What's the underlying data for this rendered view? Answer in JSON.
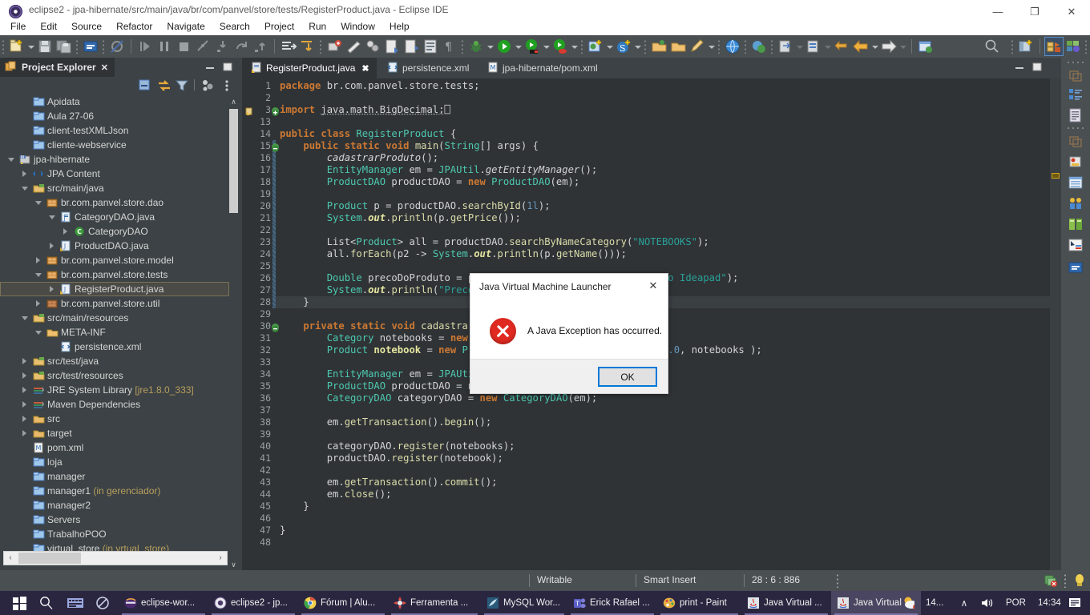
{
  "window": {
    "title": "eclipse2 - jpa-hibernate/src/main/java/br/com/panvel/store/tests/RegisterProduct.java - Eclipse IDE",
    "minimize": "—",
    "maximize": "❐",
    "close": "✕"
  },
  "menubar": [
    {
      "label": "File"
    },
    {
      "label": "Edit"
    },
    {
      "label": "Source"
    },
    {
      "label": "Refactor"
    },
    {
      "label": "Navigate"
    },
    {
      "label": "Search"
    },
    {
      "label": "Project"
    },
    {
      "label": "Run"
    },
    {
      "label": "Window"
    },
    {
      "label": "Help"
    }
  ],
  "project_explorer": {
    "tab_label": "Project Explorer",
    "tab_close": "✕",
    "tree": [
      {
        "label": "Apidata",
        "indent": 1,
        "icon": "project-closed",
        "arrow": "none"
      },
      {
        "label": "Aula 27-06",
        "indent": 1,
        "icon": "project-closed",
        "arrow": "none"
      },
      {
        "label": "client-testXMLJson",
        "indent": 1,
        "icon": "project-closed",
        "arrow": "none"
      },
      {
        "label": "cliente-webservice",
        "indent": 1,
        "icon": "project-closed",
        "arrow": "none"
      },
      {
        "label": "jpa-hibernate",
        "indent": 0,
        "icon": "maven-project",
        "arrow": "open"
      },
      {
        "label": "JPA Content",
        "indent": 1,
        "icon": "jpa-content",
        "arrow": "closed"
      },
      {
        "label": "src/main/java",
        "indent": 1,
        "icon": "source-folder",
        "arrow": "open"
      },
      {
        "label": "br.com.panvel.store.dao",
        "indent": 2,
        "icon": "package",
        "arrow": "open"
      },
      {
        "label": "CategoryDAO.java",
        "indent": 3,
        "icon": "java-file",
        "arrow": "open"
      },
      {
        "label": "CategoryDAO",
        "indent": 4,
        "icon": "class",
        "arrow": "closed"
      },
      {
        "label": "ProductDAO.java",
        "indent": 3,
        "icon": "java-file-warn",
        "arrow": "closed"
      },
      {
        "label": "br.com.panvel.store.model",
        "indent": 2,
        "icon": "package",
        "arrow": "closed"
      },
      {
        "label": "br.com.panvel.store.tests",
        "indent": 2,
        "icon": "package",
        "arrow": "open"
      },
      {
        "label": "RegisterProduct.java",
        "indent": 3,
        "icon": "java-file-warn",
        "arrow": "closed",
        "selected": true
      },
      {
        "label": "br.com.panvel.store.util",
        "indent": 2,
        "icon": "package-plain",
        "arrow": "closed"
      },
      {
        "label": "src/main/resources",
        "indent": 1,
        "icon": "source-folder",
        "arrow": "open"
      },
      {
        "label": "META-INF",
        "indent": 2,
        "icon": "folder-open",
        "arrow": "open"
      },
      {
        "label": "persistence.xml",
        "indent": 3,
        "icon": "xml-file",
        "arrow": "none"
      },
      {
        "label": "src/test/java",
        "indent": 1,
        "icon": "source-folder",
        "arrow": "closed"
      },
      {
        "label": "src/test/resources",
        "indent": 1,
        "icon": "source-folder",
        "arrow": "closed"
      },
      {
        "label": "JRE System Library",
        "suffix": "[jre1.8.0_333]",
        "indent": 1,
        "icon": "library",
        "arrow": "closed"
      },
      {
        "label": "Maven Dependencies",
        "indent": 1,
        "icon": "library",
        "arrow": "closed"
      },
      {
        "label": "src",
        "indent": 1,
        "icon": "folder",
        "arrow": "closed"
      },
      {
        "label": "target",
        "indent": 1,
        "icon": "folder",
        "arrow": "closed"
      },
      {
        "label": "pom.xml",
        "indent": 1,
        "icon": "maven-file",
        "arrow": "none"
      },
      {
        "label": "loja",
        "indent": 1,
        "icon": "project-closed",
        "arrow": "none"
      },
      {
        "label": "manager",
        "indent": 1,
        "icon": "project-closed",
        "arrow": "none"
      },
      {
        "label": "manager1",
        "suffix": "(in gerenciador)",
        "indent": 1,
        "icon": "project-closed",
        "arrow": "none"
      },
      {
        "label": "manager2",
        "indent": 1,
        "icon": "project-closed",
        "arrow": "none"
      },
      {
        "label": "Servers",
        "indent": 1,
        "icon": "project-closed",
        "arrow": "none"
      },
      {
        "label": "TrabalhoPOO",
        "indent": 1,
        "icon": "project-closed",
        "arrow": "none"
      },
      {
        "label": "virtual_store",
        "suffix": "(in vrtual_store)",
        "indent": 1,
        "icon": "project-closed",
        "arrow": "none"
      }
    ],
    "scroll_up": "∧",
    "scroll_down": "∨",
    "scroll_left": "‹",
    "scroll_right": "›"
  },
  "editor": {
    "tabs": [
      {
        "label": "RegisterProduct.java",
        "icon": "java-file-warn",
        "active": true,
        "close": "✖"
      },
      {
        "label": "persistence.xml",
        "icon": "xml-file",
        "active": false
      },
      {
        "label": "jpa-hibernate/pom.xml",
        "icon": "maven-file",
        "active": false
      }
    ],
    "code_lines": [
      {
        "num": "1",
        "html": "<span class='k'>package</span> <span class='pl'>br.com.panvel.store.tests;</span>"
      },
      {
        "num": "2",
        "html": ""
      },
      {
        "num": "3",
        "html": "<span class='k'>import</span> <span class='pl' style='text-decoration:underline dotted #aaa'>java.math.BigDecimal;</span><span class='pl'>⎕</span>",
        "fold": "plus",
        "marker": "warning"
      },
      {
        "num": "13",
        "html": ""
      },
      {
        "num": "14",
        "html": "<span class='k'>public</span> <span class='k'>class</span> <span class='t'>RegisterProduct</span> <span class='pl'>{</span>"
      },
      {
        "num": "15",
        "html": "    <span class='k'>public</span> <span class='k'>static</span> <span class='k'>void</span> <span class='mth'>main</span><span class='pl'>(</span><span class='t'>String</span><span class='pl'>[] args) {</span>",
        "fold": "minus",
        "bar": true
      },
      {
        "num": "16",
        "html": "        <span class='it' style='color:#d4d4d4'>cadastrarProduto</span><span class='pl'>();</span>",
        "bar": true
      },
      {
        "num": "17",
        "html": "        <span class='t'>EntityManager</span> <span class='pl'>em = </span><span class='t'>JPAUtil</span><span class='pl'>.</span><span class='it'>getEntityManager</span><span class='pl'>();</span>",
        "bar": true
      },
      {
        "num": "18",
        "html": "        <span class='t'>ProductDAO</span> <span class='pl'>productDAO = </span><span class='k'>new</span> <span class='t'>ProductDAO</span><span class='pl'>(em);</span>",
        "bar": true
      },
      {
        "num": "19",
        "html": "",
        "bar": true
      },
      {
        "num": "20",
        "html": "        <span class='t'>Product</span> <span class='pl'>p = productDAO.</span><span class='mth'>searchById</span><span class='pl'>(</span><span class='n'>1l</span><span class='pl'>);</span>",
        "bar": true
      },
      {
        "num": "21",
        "html": "        <span class='t'>System</span><span class='pl'>.</span><span class='fld'>out</span><span class='pl'>.</span><span class='mth'>println</span><span class='pl'>(p.</span><span class='mth'>getPrice</span><span class='pl'>());</span>",
        "bar": true
      },
      {
        "num": "22",
        "html": "",
        "bar": true
      },
      {
        "num": "23",
        "html": "        <span class='pl'>List&lt;</span><span class='t'>Product</span><span class='pl'>&gt; all = productDAO.</span><span class='mth'>searchByNameCategory</span><span class='pl'>(</span><span class='str'>\"NOTEBOOKS\"</span><span class='pl'>);</span>",
        "bar": true
      },
      {
        "num": "24",
        "html": "        <span class='pl'>all.</span><span class='mth'>forEach</span><span class='pl'>(p2 -&gt; </span><span class='t'>System</span><span class='pl'>.</span><span class='fld'>out</span><span class='pl'>.</span><span class='mth'>println</span><span class='pl'>(p.</span><span class='mth'>getName</span><span class='pl'>()));</span>",
        "bar": true
      },
      {
        "num": "25",
        "html": "",
        "bar": true
      },
      {
        "num": "26",
        "html": "        <span class='t'>Double</span> <span class='pl'>precoDoProduto = pr</span><span class='pl'>                         </span><span class='pl'>(</span><span class='str'>\"Lenovo Ideapad\"</span><span class='pl'>);</span>",
        "bar": true
      },
      {
        "num": "27",
        "html": "        <span class='t'>System</span><span class='pl'>.</span><span class='fld'>out</span><span class='pl'>.</span><span class='mth'>println</span><span class='pl'>(</span><span class='str'>\"Preco </span>",
        "bar": true
      },
      {
        "num": "28",
        "html": "    <span class='pl'>}</span>",
        "bar": true,
        "highlight": true
      },
      {
        "num": "29",
        "html": ""
      },
      {
        "num": "30",
        "html": "    <span class='k'>private</span> <span class='k'>static</span> <span class='k'>void</span> <span class='mth'>cadastrarP</span>",
        "fold": "minus"
      },
      {
        "num": "31",
        "html": "        <span class='t'>Category</span> <span class='pl'>notebooks = </span><span class='k'>new</span> <span class='t'>C</span>"
      },
      {
        "num": "32",
        "html": "        <span class='t'>Product</span> <span class='var' style=\"color:#e6e6a0;font-weight:bold\">notebook</span> <span class='pl'>= </span><span class='k'>new</span> <span class='t'>Pro</span><span class='pl'>                   </span><span class='str'>estudos\"</span><span class='pl'>, </span><span class='n'>800.0</span><span class='pl'>, notebooks );</span>"
      },
      {
        "num": "33",
        "html": ""
      },
      {
        "num": "34",
        "html": "        <span class='t'>EntityManager</span> <span class='pl'>em = </span><span class='t'>JPAUtil</span>"
      },
      {
        "num": "35",
        "html": "        <span class='t'>ProductDAO</span> <span class='pl'>productDAO = ne</span>"
      },
      {
        "num": "36",
        "html": "        <span class='t'>CategoryDAO</span> <span class='pl'>categoryDAO = </span><span class='k'>new</span> <span class='t'>CategoryDAO</span><span class='pl'>(em);</span>"
      },
      {
        "num": "37",
        "html": ""
      },
      {
        "num": "38",
        "html": "        <span class='pl'>em.</span><span class='mth'>getTransaction</span><span class='pl'>().</span><span class='mth'>begin</span><span class='pl'>();</span>"
      },
      {
        "num": "39",
        "html": ""
      },
      {
        "num": "40",
        "html": "        <span class='pl'>categoryDAO.</span><span class='mth'>register</span><span class='pl'>(notebooks);</span>"
      },
      {
        "num": "41",
        "html": "        <span class='pl'>productDAO.</span><span class='mth'>register</span><span class='pl'>(notebook);</span>"
      },
      {
        "num": "42",
        "html": ""
      },
      {
        "num": "43",
        "html": "        <span class='pl'>em.</span><span class='mth'>getTransaction</span><span class='pl'>().</span><span class='mth'>commit</span><span class='pl'>();</span>"
      },
      {
        "num": "44",
        "html": "        <span class='pl'>em.</span><span class='mth'>close</span><span class='pl'>();</span>"
      },
      {
        "num": "45",
        "html": "    <span class='pl'>}</span>"
      },
      {
        "num": "46",
        "html": ""
      },
      {
        "num": "47",
        "html": "<span class='pl'>}</span>"
      },
      {
        "num": "48",
        "html": ""
      }
    ]
  },
  "dialog": {
    "title": "Java Virtual Machine Launcher",
    "close": "✕",
    "message": "A Java Exception has occurred.",
    "ok_label": "OK",
    "accent": "#0078d7",
    "error_color": "#e02a21"
  },
  "statusbar": {
    "writable": "Writable",
    "insert_mode": "Smart Insert",
    "position": "28 : 6 : 886"
  },
  "taskbar": {
    "start": "start-icon",
    "search": "search-icon",
    "taskview": "task-view-icon",
    "cortana": "cortana-icon",
    "items": [
      {
        "label": "eclipse-wor...",
        "icon": "eclipse-icon",
        "running": true
      },
      {
        "label": "eclipse2 - jp...",
        "icon": "eclipse-icon",
        "running": true
      },
      {
        "label": "Fórum | Alu...",
        "icon": "chrome-icon",
        "running": true
      },
      {
        "label": "Ferramenta ...",
        "icon": "tool-icon",
        "running": true
      },
      {
        "label": "MySQL Wor...",
        "icon": "mysql-icon",
        "running": true
      },
      {
        "label": "Erick Rafael ...",
        "icon": "teams-icon",
        "running": true
      },
      {
        "label": "print - Paint",
        "icon": "paint-icon",
        "running": true
      },
      {
        "label": "Java Virtual ...",
        "icon": "java-icon",
        "running": true
      },
      {
        "label": "Java Virtual ...",
        "icon": "java-icon",
        "running": true,
        "active": true
      }
    ],
    "weather": "14...",
    "tray_expand": "∧",
    "volume": "volume-icon",
    "language": "POR",
    "clock": "14:34",
    "notifications": "notification-icon"
  }
}
